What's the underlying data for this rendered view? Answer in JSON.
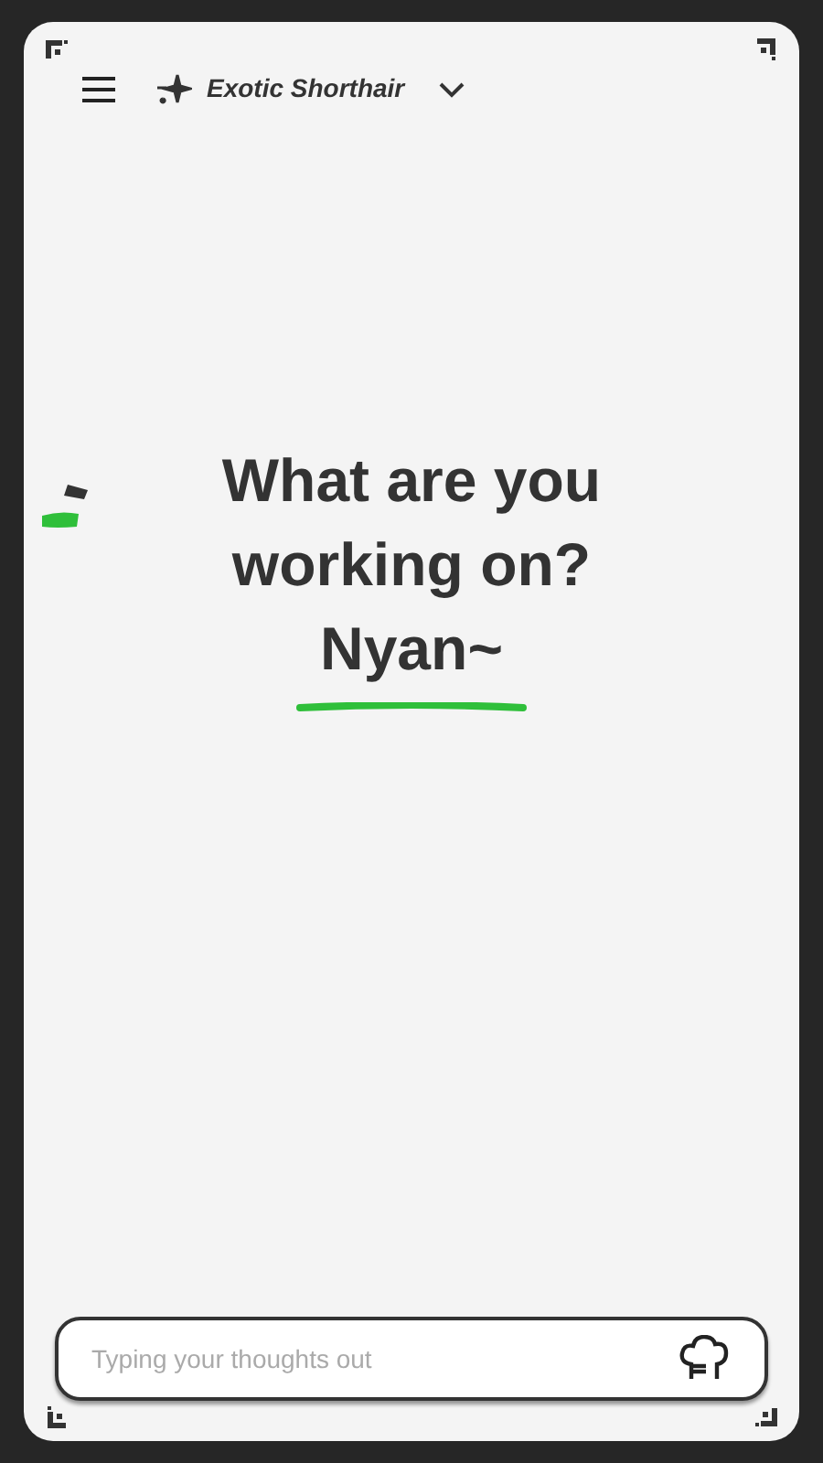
{
  "header": {
    "model_name": "Exotic Shorthair"
  },
  "greeting": {
    "lines": [
      "What are you",
      "working on?"
    ],
    "name": "Nyan~"
  },
  "composer": {
    "placeholder": "Typing your thoughts out"
  }
}
